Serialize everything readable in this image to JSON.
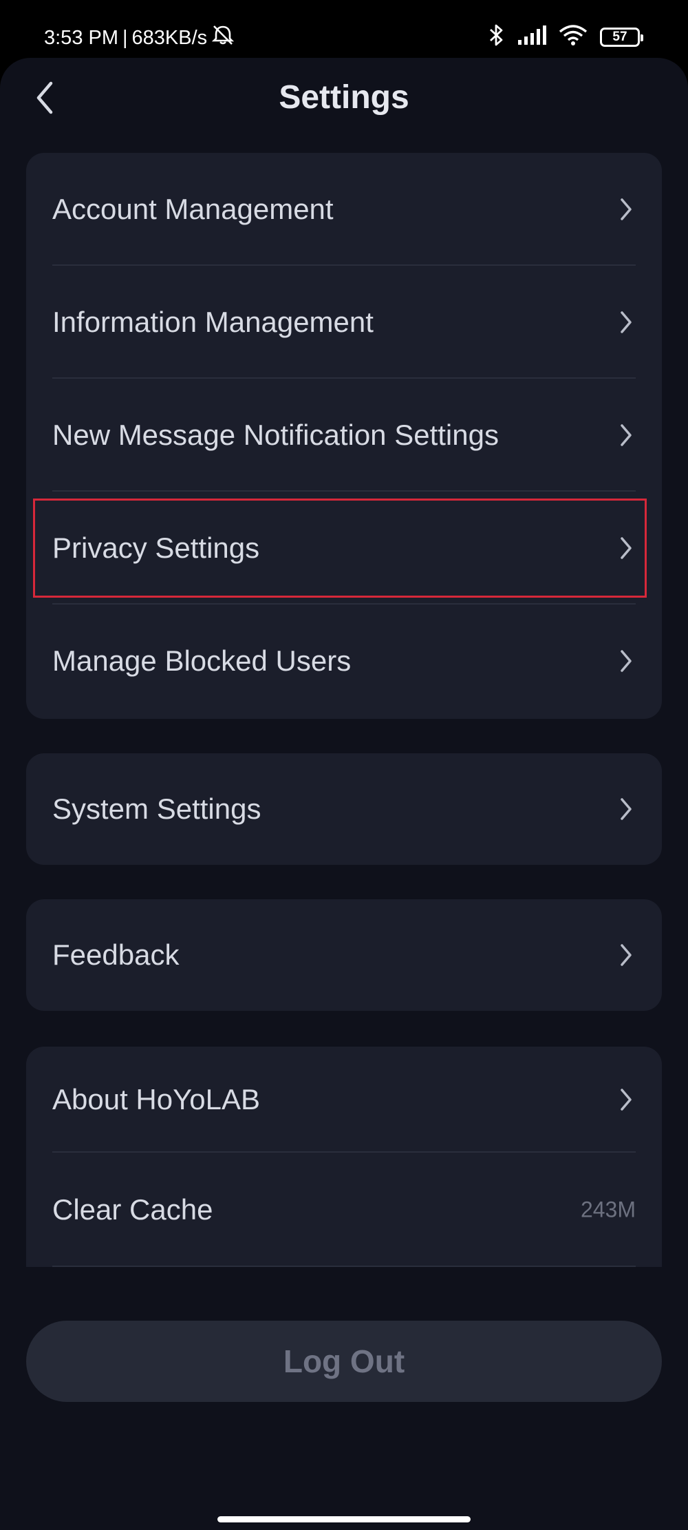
{
  "status_bar": {
    "time": "3:53 PM",
    "separator": "|",
    "speed": "683KB/s",
    "battery": "57"
  },
  "header": {
    "title": "Settings",
    "back_icon": "chevron-left-icon"
  },
  "group1": {
    "items": [
      {
        "label": "Account Management"
      },
      {
        "label": "Information Management"
      },
      {
        "label": "New Message Notification Settings"
      },
      {
        "label": "Privacy Settings",
        "highlighted": true
      },
      {
        "label": "Manage Blocked Users"
      }
    ]
  },
  "group2": {
    "items": [
      {
        "label": "System Settings"
      }
    ]
  },
  "group3": {
    "items": [
      {
        "label": "Feedback"
      }
    ]
  },
  "group4": {
    "items": [
      {
        "label": "About HoYoLAB"
      },
      {
        "label": "Clear Cache",
        "value": "243M"
      }
    ]
  },
  "logout": {
    "label": "Log Out"
  },
  "colors": {
    "background": "#0f111b",
    "card": "#1b1e2b",
    "highlight": "#d6283a"
  }
}
